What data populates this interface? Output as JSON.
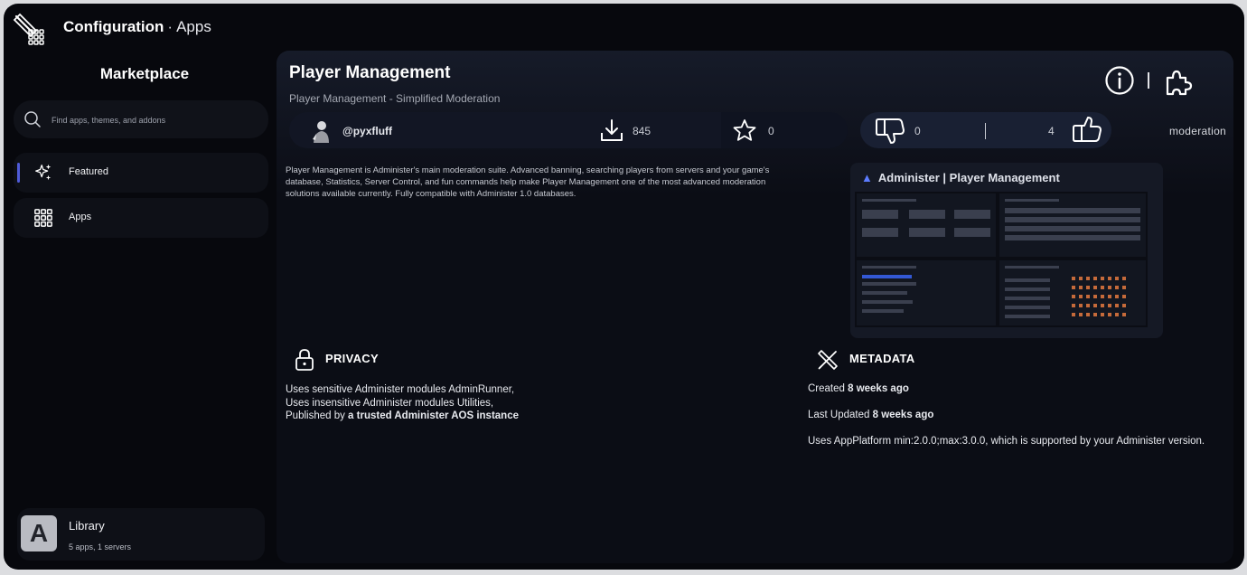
{
  "header": {
    "section": "Configuration",
    "separator": "·",
    "page": "Apps"
  },
  "sidebar": {
    "title": "Marketplace",
    "search_placeholder": "Find apps, themes, and addons",
    "items": [
      {
        "label": "Featured",
        "icon": "sparkles-icon",
        "active": true
      },
      {
        "label": "Apps",
        "icon": "grid-icon",
        "active": false
      }
    ],
    "library": {
      "name": "Library",
      "avatar_letter": "A",
      "summary": "5 apps, 1 servers"
    }
  },
  "app": {
    "title": "Player Management",
    "subtitle": "Player Management - Simplified Moderation",
    "author": "@pyxfluff",
    "downloads": "845",
    "stars": "0",
    "dislikes": "0",
    "likes": "4",
    "tag": "moderation",
    "description": "Player Management is Administer's main moderation suite. Advanced banning, searching players from servers and your game's database, Statistics, Server Control, and fun commands help make Player Management one of the most advanced moderation solutions available currently. Fully compatible with Administer 1.0 databases.",
    "screenshot": {
      "brand": "Administer",
      "title_sep": "|",
      "title": "Player Management"
    }
  },
  "privacy": {
    "heading": "PRIVACY",
    "line1": "Uses sensitive Administer modules AdminRunner,",
    "line2": "Uses insensitive Administer modules Utilities,",
    "line3_prefix": "Published by ",
    "line3_bold": "a trusted Administer AOS instance"
  },
  "metadata": {
    "heading": "METADATA",
    "created_label": "Created ",
    "created_value": "8 weeks ago",
    "updated_label": "Last Updated ",
    "updated_value": "8 weeks ago",
    "platform": "Uses AppPlatform min:2.0.0;max:3.0.0, which is supported by your Administer version."
  },
  "colors": {
    "window_bg": "#07080d",
    "panel_bg": "#0b0d15",
    "accent": "#4f5bd8"
  }
}
